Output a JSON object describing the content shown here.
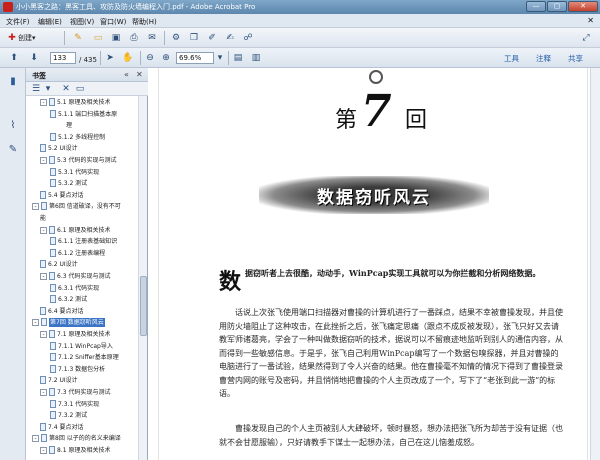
{
  "window": {
    "title": "小小黑客之路：黑客工具、攻防及防火墙编程入门.pdf - Adobe Acrobat Pro",
    "min_label": "—",
    "max_label": "▢",
    "close_label": "✕"
  },
  "menu": {
    "items": [
      "文件(F)",
      "编辑(E)",
      "视图(V)",
      "窗口(W)",
      "帮助(H)"
    ],
    "close": "✕"
  },
  "toolbar": {
    "create_label": "创建",
    "create_arrow": "▾"
  },
  "nav_toolbar": {
    "current_page": "133",
    "total_pages": "/ 435",
    "zoom": "69.6%",
    "links": [
      "工具",
      "注释",
      "共享"
    ]
  },
  "bookmarks": {
    "title": "书签",
    "items": [
      {
        "label": "5.1 原理及相关技术",
        "indent": 2,
        "toggle": "-",
        "selected": false
      },
      {
        "label": "5.1.1 端口扫描基本原",
        "indent": 3,
        "toggle": "",
        "selected": false
      },
      {
        "label": "理",
        "indent": 4,
        "toggle": "",
        "selected": false,
        "cont": true
      },
      {
        "label": "5.1.2 多线程控制",
        "indent": 3,
        "toggle": "",
        "selected": false
      },
      {
        "label": "5.2 UI设计",
        "indent": 2,
        "toggle": "",
        "selected": false
      },
      {
        "label": "5.3 代码的实现与测试",
        "indent": 2,
        "toggle": "-",
        "selected": false
      },
      {
        "label": "5.3.1 代码实现",
        "indent": 3,
        "toggle": "",
        "selected": false
      },
      {
        "label": "5.3.2 测试",
        "indent": 3,
        "toggle": "",
        "selected": false
      },
      {
        "label": "5.4 要点对话",
        "indent": 2,
        "toggle": "",
        "selected": false
      },
      {
        "label": "第6回 信道破译，没有不可",
        "indent": 1,
        "toggle": "-",
        "selected": false
      },
      {
        "label": "能",
        "indent": 2,
        "toggle": "",
        "selected": false,
        "cont": true
      },
      {
        "label": "6.1 原理及相关技术",
        "indent": 2,
        "toggle": "-",
        "selected": false
      },
      {
        "label": "6.1.1 注册表基础知识",
        "indent": 3,
        "toggle": "",
        "selected": false
      },
      {
        "label": "6.1.2 注册表编程",
        "indent": 3,
        "toggle": "",
        "selected": false
      },
      {
        "label": "6.2 UI设计",
        "indent": 2,
        "toggle": "",
        "selected": false
      },
      {
        "label": "6.3 代码实现与测试",
        "indent": 2,
        "toggle": "-",
        "selected": false
      },
      {
        "label": "6.3.1 代码实现",
        "indent": 3,
        "toggle": "",
        "selected": false
      },
      {
        "label": "6.3.2 测试",
        "indent": 3,
        "toggle": "",
        "selected": false
      },
      {
        "label": "6.4 要点对话",
        "indent": 2,
        "toggle": "",
        "selected": false
      },
      {
        "label": "第7回 数据窃听风云",
        "indent": 1,
        "toggle": "-",
        "selected": true
      },
      {
        "label": "7.1 原理及相关技术",
        "indent": 2,
        "toggle": "-",
        "selected": false
      },
      {
        "label": "7.1.1 WinPcap导入",
        "indent": 3,
        "toggle": "",
        "selected": false
      },
      {
        "label": "7.1.2 Sniffer基本原理",
        "indent": 3,
        "toggle": "",
        "selected": false
      },
      {
        "label": "7.1.3 数据包分析",
        "indent": 3,
        "toggle": "",
        "selected": false
      },
      {
        "label": "7.2 UI设计",
        "indent": 2,
        "toggle": "",
        "selected": false
      },
      {
        "label": "7.3 代码实现与测试",
        "indent": 2,
        "toggle": "-",
        "selected": false
      },
      {
        "label": "7.3.1 代码实现",
        "indent": 3,
        "toggle": "",
        "selected": false
      },
      {
        "label": "7.3.2 测试",
        "indent": 3,
        "toggle": "",
        "selected": false
      },
      {
        "label": "7.4 要点对话",
        "indent": 2,
        "toggle": "",
        "selected": false
      },
      {
        "label": "第8回 以子的的名义来编译",
        "indent": 1,
        "toggle": "-",
        "selected": false
      },
      {
        "label": "8.1 原理及相关技术",
        "indent": 2,
        "toggle": "-",
        "selected": false
      }
    ]
  },
  "document": {
    "chapter_prefix": "第",
    "chapter_num": "7",
    "chapter_suffix": "回",
    "chapter_title": "数据窃听风云",
    "lead_char": "数",
    "lead_text": "据窃听者上去很酷，动动手，WinPcap实现工具就可以为你拦截和分析网络数据。",
    "p1": "话说上次张飞使用端口扫描器对曹操的计算机进行了一番踩点，结果不幸被曹操发现，并且使用防火墙阻止了这种攻击，在此挫折之后，张飞痛定思痛（跟点不成反被发现），张飞只好又去请教军师诸葛亮，学会了一种叫做数据窃听的技术，据说可以不留痕迹地监听到别人的通信内容，从而得到一些敏感信息。于是乎，张飞自己利用WinPcap编写了一个数据包嗅探器，并且对曹操的电脑进行了一番试验，结果然得到了令人兴奋的结果。他在曹操毫不知情的情况下得到了曹操登录曹营内网的账号及密码，并且悄悄地把曹操的个人主页改成了一个，写下了“老张到此一游”的标语。",
    "p2": "曹操发现自己的个人主页被别人大肆破坏，顿时暴怒，想办法把张飞所为却苦于没有证据（也就不会甘愿服输），只好请教手下谋士一起想办法，自己在这儿恼羞成怒。"
  }
}
